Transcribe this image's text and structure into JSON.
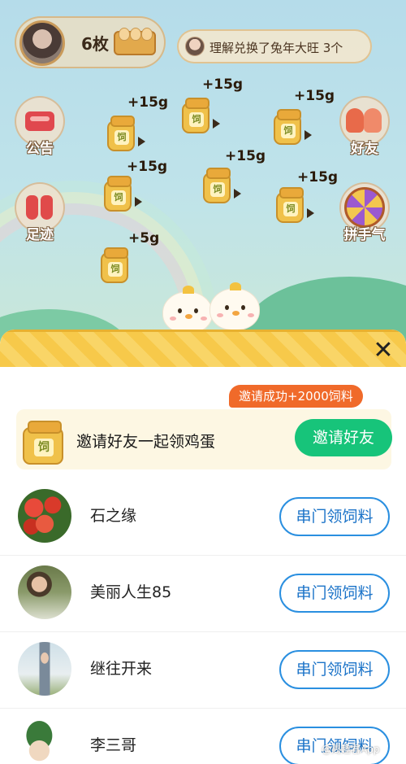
{
  "top_bar": {
    "egg_count": "6枚",
    "notice_text": "理解兑换了兔年大旺 3个"
  },
  "side_buttons": {
    "announcement": "公告",
    "footprints": "足迹",
    "friends": "好友",
    "lucky": "拼手气"
  },
  "feed_items": [
    {
      "amount": "+15g",
      "jar_label": "饲"
    },
    {
      "amount": "+15g",
      "jar_label": "饲"
    },
    {
      "amount": "+15g",
      "jar_label": "饲"
    },
    {
      "amount": "+15g",
      "jar_label": "饲"
    },
    {
      "amount": "+15g",
      "jar_label": "饲"
    },
    {
      "amount": "+15g",
      "jar_label": "饲"
    },
    {
      "amount": "+5g",
      "jar_label": "饲"
    }
  ],
  "panel": {
    "close_icon": "✕",
    "invite_badge": "邀请成功+2000饲料",
    "invite_jar_label": "饲",
    "invite_title": "邀请好友一起领鸡蛋",
    "invite_button": "邀请好友",
    "friends": [
      {
        "name": "石之缘",
        "button": "串门领饲料"
      },
      {
        "name": "美丽人生85",
        "button": "串门领饲料"
      },
      {
        "name": "继往开来",
        "button": "串门领饲料"
      },
      {
        "name": "李三哥",
        "button": "串门领饲料"
      }
    ]
  },
  "watermark": "@周趣看App",
  "colors": {
    "invite_green": "#17c47a",
    "visit_blue": "#2a8fe0",
    "badge_orange": "#f06a2a",
    "header_yellow": "#f7c94a"
  }
}
